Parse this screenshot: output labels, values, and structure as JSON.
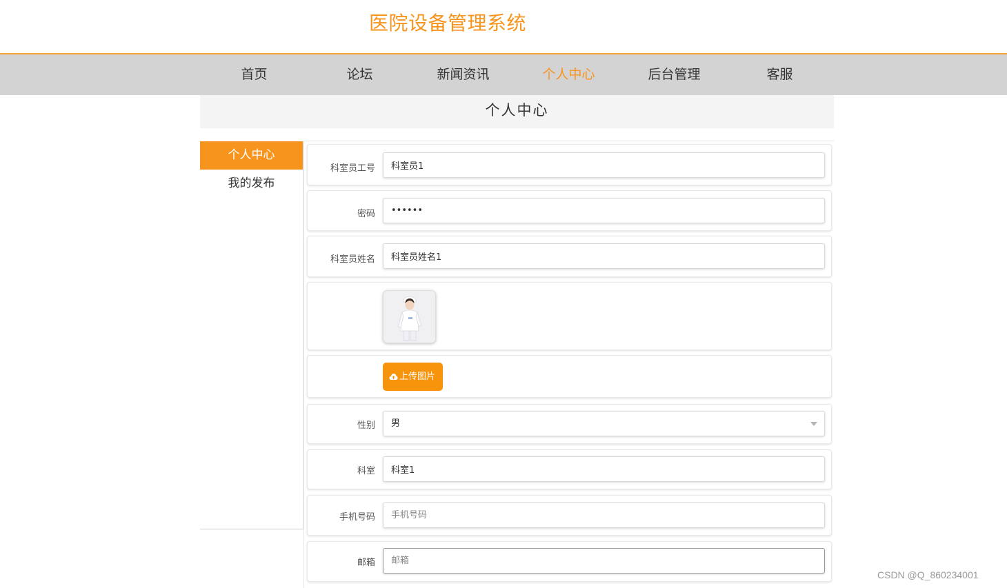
{
  "site": {
    "title": "医院设备管理系统"
  },
  "nav": {
    "items": [
      {
        "label": "首页"
      },
      {
        "label": "论坛"
      },
      {
        "label": "新闻资讯"
      },
      {
        "label": "个人中心"
      },
      {
        "label": "后台管理"
      },
      {
        "label": "客服"
      }
    ],
    "active_index": 3
  },
  "banner": {
    "title": "个人中心"
  },
  "side_menu": {
    "items": [
      {
        "label": "个人中心"
      },
      {
        "label": "我的发布"
      }
    ],
    "active_index": 0
  },
  "form": {
    "staff_id": {
      "label": "科室员工号",
      "value": "科室员1"
    },
    "password": {
      "label": "密码",
      "value": "123456"
    },
    "staff_name": {
      "label": "科室员姓名",
      "value": "科室员姓名1"
    },
    "avatar": {
      "icon": "nurse-photo"
    },
    "upload": {
      "label": "上传图片",
      "icon": "cloud-upload-icon"
    },
    "gender": {
      "label": "性别",
      "value": "男"
    },
    "department": {
      "label": "科室",
      "value": "科室1"
    },
    "phone": {
      "label": "手机号码",
      "value": "",
      "placeholder": "手机号码"
    },
    "email": {
      "label": "邮箱",
      "value": "",
      "placeholder": "邮箱"
    }
  },
  "watermark": {
    "text": "CSDN @Q_860234001"
  },
  "colors": {
    "accent": "#f7941d",
    "nav_bg": "#d3d3d3",
    "banner_bg": "#f4f4f4"
  }
}
